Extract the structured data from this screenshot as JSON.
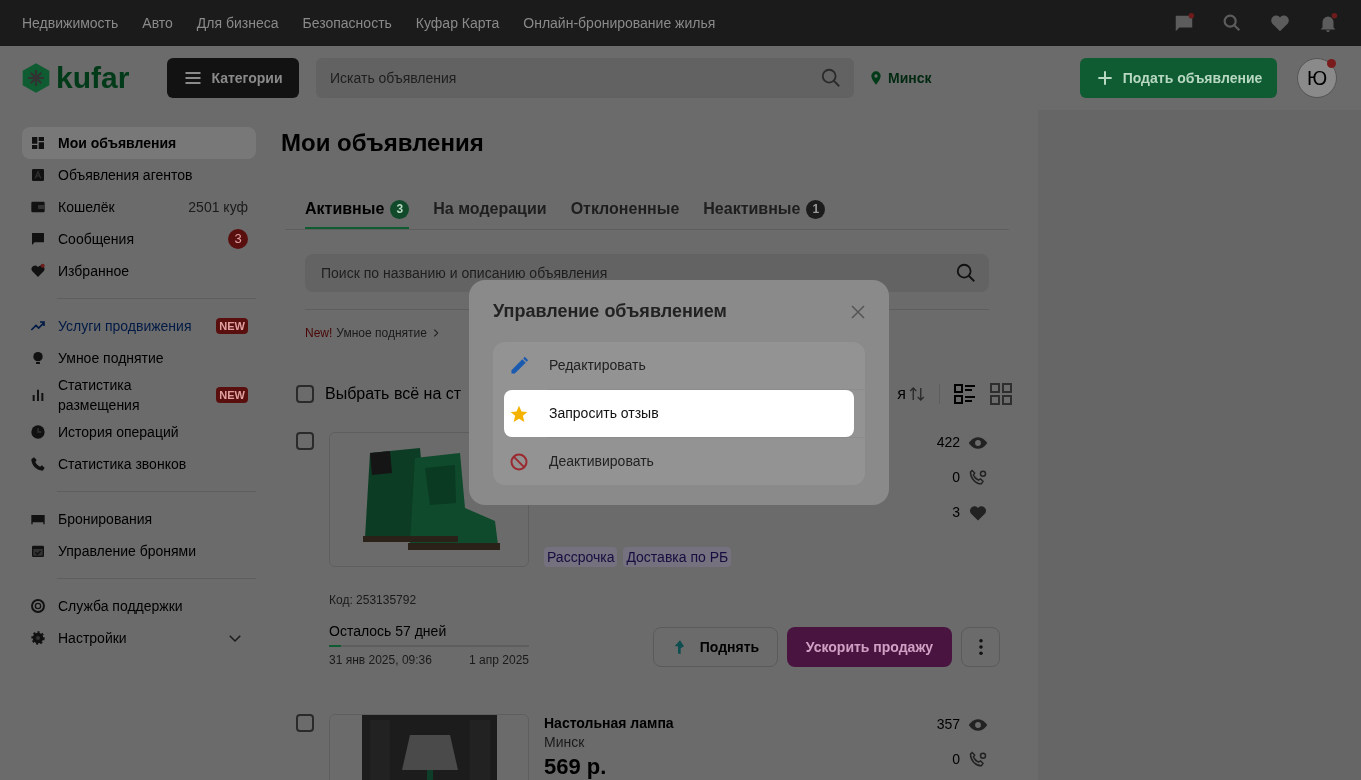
{
  "top_nav": {
    "links": [
      "Недвижимость",
      "Авто",
      "Для бизнеса",
      "Безопасность",
      "Куфар Карта",
      "Онлайн-бронирование жилья"
    ]
  },
  "header": {
    "logo": "kufar",
    "categories_button": "Категории",
    "search": {
      "placeholder": "Искать объявления"
    },
    "location": "Минск",
    "post_button": "Подать объявление",
    "avatar": "Ю"
  },
  "sidebar": {
    "groups": [
      [
        {
          "label": "Мои объявления",
          "kind": "plain",
          "selected": true
        },
        {
          "label": "Объявления агентов",
          "kind": "plain",
          "selected": false
        },
        {
          "label": "Кошелёк",
          "kind": "plain",
          "selected": false,
          "value": "2501 куф"
        },
        {
          "label": "Сообщения",
          "kind": "plain",
          "selected": false,
          "badge": "3"
        },
        {
          "label": "Избранное",
          "kind": "plain",
          "selected": false
        }
      ],
      [
        {
          "label": "Услуги продвижения",
          "kind": "accent",
          "selected": false,
          "tag": "NEW"
        },
        {
          "label": "Умное поднятие",
          "kind": "plain",
          "selected": false
        },
        {
          "label": "Статистика размещения",
          "kind": "plain",
          "selected": false,
          "tag": "NEW"
        },
        {
          "label": "История операций",
          "kind": "plain",
          "selected": false
        },
        {
          "label": "Статистика звонков",
          "kind": "plain",
          "selected": false
        }
      ],
      [
        {
          "label": "Бронирования",
          "kind": "plain",
          "selected": false
        },
        {
          "label": "Управление бронями",
          "kind": "plain",
          "selected": false
        }
      ],
      [
        {
          "label": "Служба поддержки",
          "kind": "plain",
          "selected": false
        },
        {
          "label": "Настройки",
          "kind": "collapsible",
          "selected": false,
          "expanded": false
        }
      ]
    ]
  },
  "main": {
    "title": "Мои объявления",
    "tabs": [
      {
        "label": "Активные",
        "count": "3",
        "selected": true
      },
      {
        "label": "На модерации",
        "selected": false
      },
      {
        "label": "Отклоненные",
        "selected": false
      },
      {
        "label": "Неактивные",
        "count": "1",
        "selected": false
      }
    ],
    "search": {
      "placeholder": "Поиск по названию и описанию объявления"
    },
    "promo": {
      "badge": "New!",
      "text": "Умное поднятие"
    },
    "toolbar": {
      "checked": false,
      "select_all": "Выбрать всё на ст",
      "sort_label": "я",
      "views": [
        {
          "selected": true
        },
        {
          "selected": false
        }
      ]
    },
    "listings": [
      {
        "checked": false,
        "stats": [
          "422",
          "0",
          "3"
        ],
        "tags": [
          "Рассрочка",
          "Доставка по РБ"
        ],
        "code": "Код: 253135792",
        "remaining": "Осталось 57 дней",
        "level": 0.06,
        "start": "31 янв 2025, 09:36",
        "end": "1 апр 2025",
        "raise_button": "Поднять",
        "boost_button": "Ускорить продажу"
      },
      {
        "checked": false,
        "stats": [
          "357",
          "0"
        ],
        "title": "Настольная лампа",
        "city": "Минск",
        "price": "569 р."
      }
    ]
  },
  "modal": {
    "title": "Управление объявлением",
    "items": [
      {
        "label": "Редактировать",
        "selected": false
      },
      {
        "label": "Запросить отзыв",
        "selected": true
      },
      {
        "label": "Деактивировать",
        "selected": false
      }
    ]
  }
}
